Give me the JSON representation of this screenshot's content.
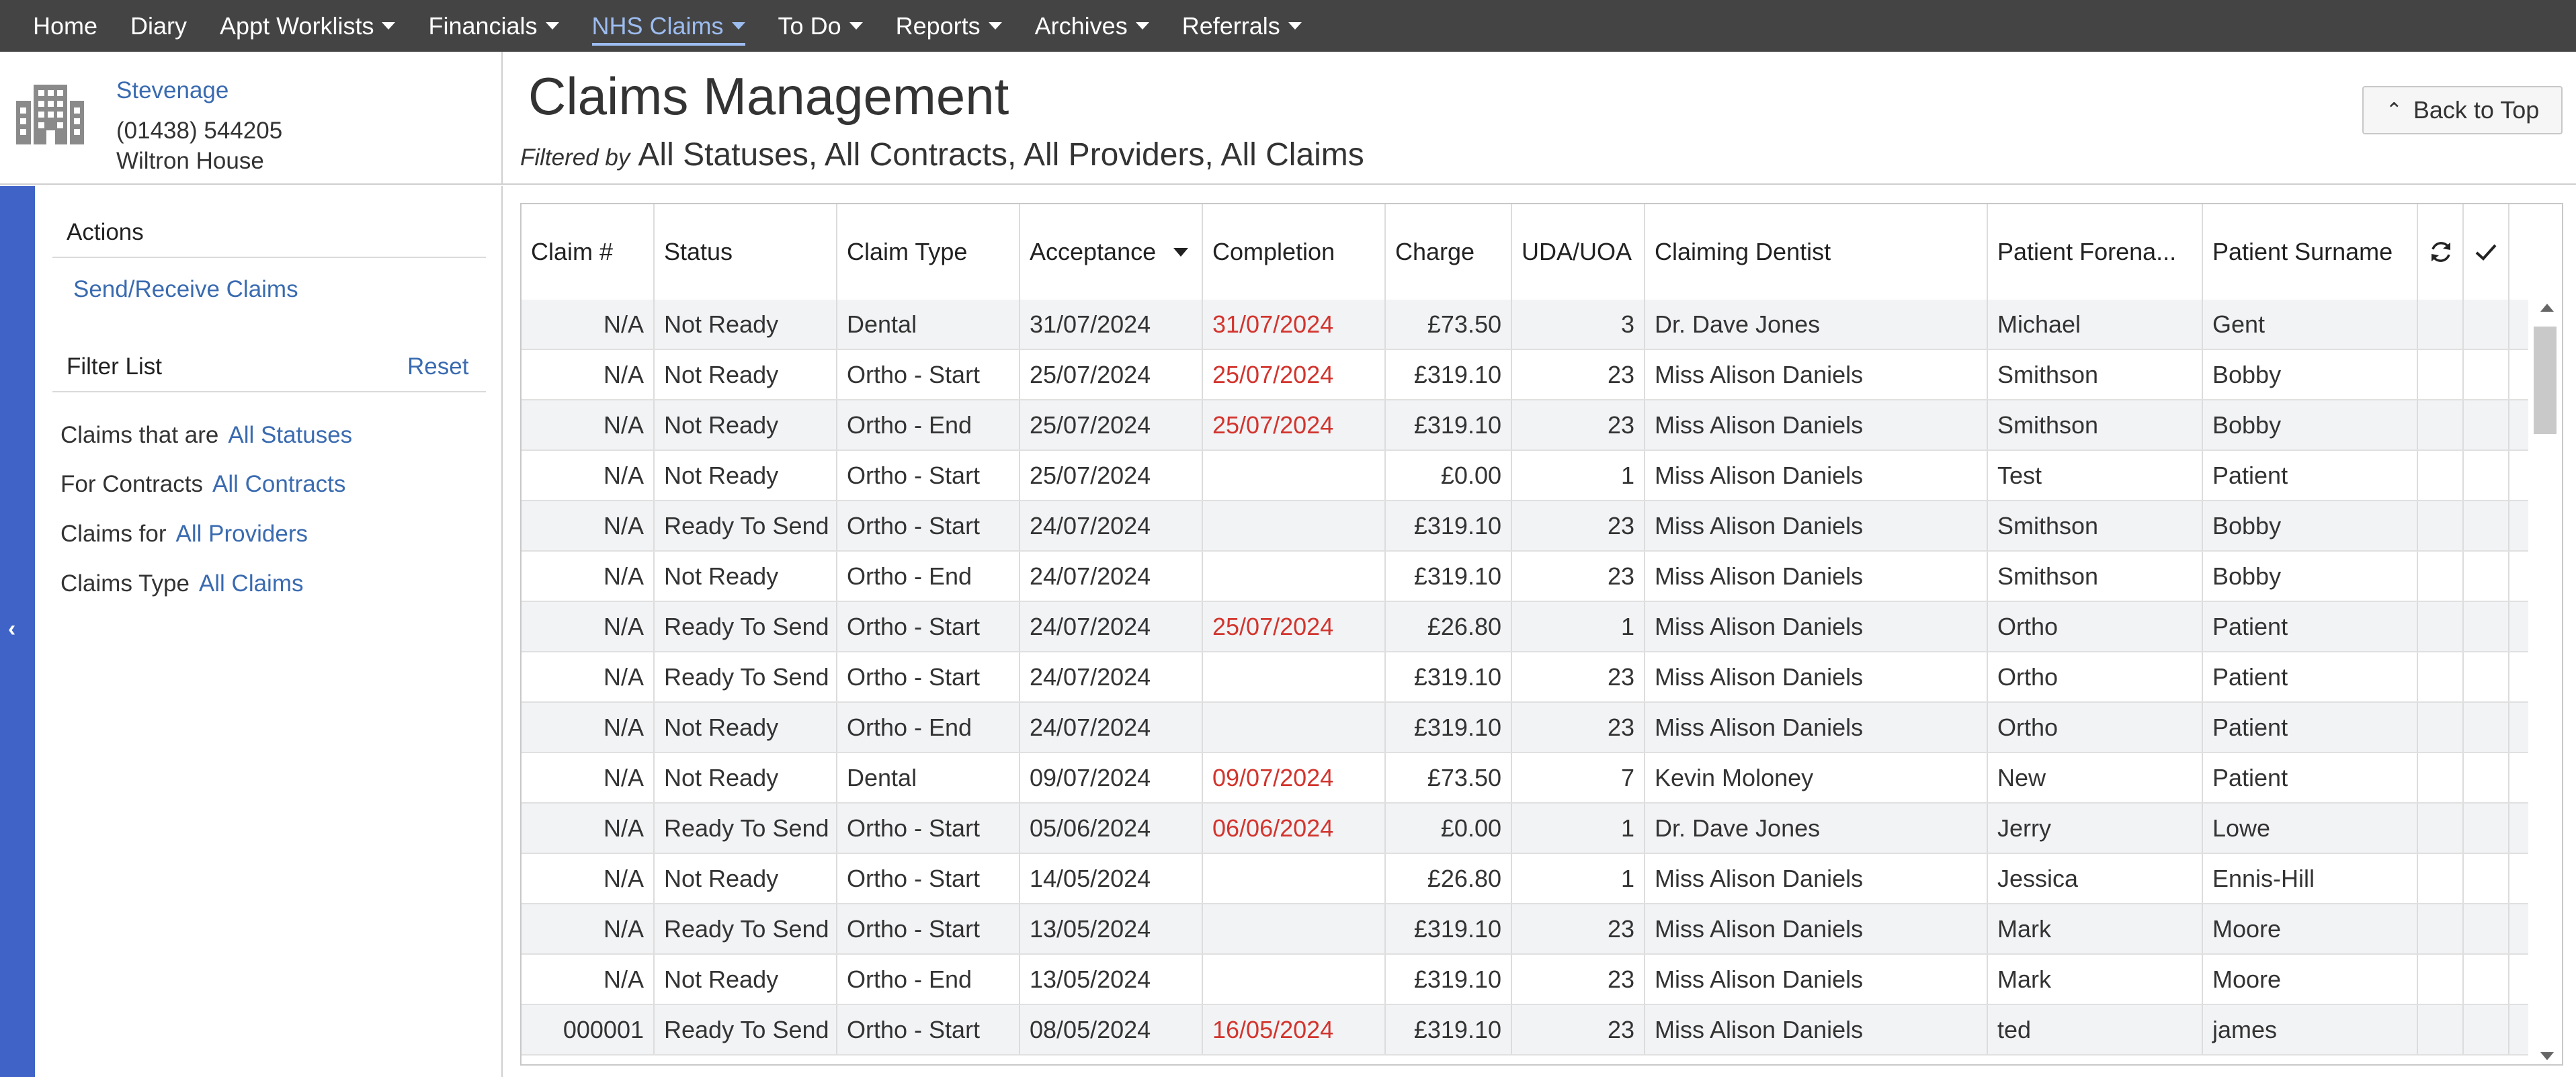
{
  "nav": {
    "items": [
      {
        "label": "Home",
        "dropdown": false,
        "active": false
      },
      {
        "label": "Diary",
        "dropdown": false,
        "active": false
      },
      {
        "label": "Appt Worklists",
        "dropdown": true,
        "active": false
      },
      {
        "label": "Financials",
        "dropdown": true,
        "active": false
      },
      {
        "label": "NHS Claims",
        "dropdown": true,
        "active": true
      },
      {
        "label": "To Do",
        "dropdown": true,
        "active": false
      },
      {
        "label": "Reports",
        "dropdown": true,
        "active": false
      },
      {
        "label": "Archives",
        "dropdown": true,
        "active": false
      },
      {
        "label": "Referrals",
        "dropdown": true,
        "active": false
      }
    ]
  },
  "practice": {
    "name": "Stevenage",
    "phone": "(01438) 544205",
    "address": "Wiltron House",
    "icon": "building-icon"
  },
  "header": {
    "title": "Claims Management",
    "filtered_by_label": "Filtered by",
    "filtered_by_value": "All Statuses, All Contracts, All Providers, All Claims",
    "back_to_top": "Back to Top"
  },
  "sidebar": {
    "actions_heading": "Actions",
    "send_receive": "Send/Receive Claims",
    "filter_heading": "Filter List",
    "reset": "Reset",
    "filters": [
      {
        "label": "Claims that are",
        "value": "All Statuses"
      },
      {
        "label": "For Contracts",
        "value": "All Contracts"
      },
      {
        "label": "Claims for",
        "value": "All Providers"
      },
      {
        "label": "Claims Type",
        "value": "All Claims"
      }
    ]
  },
  "table": {
    "columns": [
      "Claim #",
      "Status",
      "Claim Type",
      "Acceptance",
      "Completion",
      "Charge",
      "UDA/UOA",
      "Claiming Dentist",
      "Patient Forena...",
      "Patient Surname"
    ],
    "rows": [
      {
        "claim": "N/A",
        "status": "Not Ready",
        "type": "Dental",
        "acceptance": "31/07/2024",
        "completion": "31/07/2024",
        "charge": "£73.50",
        "uda": "3",
        "dentist": "Dr. Dave Jones",
        "forename": "Michael",
        "surname": "Gent"
      },
      {
        "claim": "N/A",
        "status": "Not Ready",
        "type": "Ortho - Start",
        "acceptance": "25/07/2024",
        "completion": "25/07/2024",
        "charge": "£319.10",
        "uda": "23",
        "dentist": "Miss Alison Daniels",
        "forename": "Smithson",
        "surname": "Bobby"
      },
      {
        "claim": "N/A",
        "status": "Not Ready",
        "type": "Ortho - End",
        "acceptance": "25/07/2024",
        "completion": "25/07/2024",
        "charge": "£319.10",
        "uda": "23",
        "dentist": "Miss Alison Daniels",
        "forename": "Smithson",
        "surname": "Bobby"
      },
      {
        "claim": "N/A",
        "status": "Not Ready",
        "type": "Ortho - Start",
        "acceptance": "25/07/2024",
        "completion": "",
        "charge": "£0.00",
        "uda": "1",
        "dentist": "Miss Alison Daniels",
        "forename": "Test",
        "surname": "Patient"
      },
      {
        "claim": "N/A",
        "status": "Ready To Send",
        "type": "Ortho - Start",
        "acceptance": "24/07/2024",
        "completion": "",
        "charge": "£319.10",
        "uda": "23",
        "dentist": "Miss Alison Daniels",
        "forename": "Smithson",
        "surname": "Bobby"
      },
      {
        "claim": "N/A",
        "status": "Not Ready",
        "type": "Ortho - End",
        "acceptance": "24/07/2024",
        "completion": "",
        "charge": "£319.10",
        "uda": "23",
        "dentist": "Miss Alison Daniels",
        "forename": "Smithson",
        "surname": "Bobby"
      },
      {
        "claim": "N/A",
        "status": "Ready To Send",
        "type": "Ortho - Start",
        "acceptance": "24/07/2024",
        "completion": "25/07/2024",
        "charge": "£26.80",
        "uda": "1",
        "dentist": "Miss Alison Daniels",
        "forename": "Ortho",
        "surname": "Patient"
      },
      {
        "claim": "N/A",
        "status": "Ready To Send",
        "type": "Ortho - Start",
        "acceptance": "24/07/2024",
        "completion": "",
        "charge": "£319.10",
        "uda": "23",
        "dentist": "Miss Alison Daniels",
        "forename": "Ortho",
        "surname": "Patient"
      },
      {
        "claim": "N/A",
        "status": "Not Ready",
        "type": "Ortho - End",
        "acceptance": "24/07/2024",
        "completion": "",
        "charge": "£319.10",
        "uda": "23",
        "dentist": "Miss Alison Daniels",
        "forename": "Ortho",
        "surname": "Patient"
      },
      {
        "claim": "N/A",
        "status": "Not Ready",
        "type": "Dental",
        "acceptance": "09/07/2024",
        "completion": "09/07/2024",
        "charge": "£73.50",
        "uda": "7",
        "dentist": "Kevin Moloney",
        "forename": "New",
        "surname": "Patient"
      },
      {
        "claim": "N/A",
        "status": "Ready To Send",
        "type": "Ortho - Start",
        "acceptance": "05/06/2024",
        "completion": "06/06/2024",
        "charge": "£0.00",
        "uda": "1",
        "dentist": "Dr. Dave Jones",
        "forename": "Jerry",
        "surname": "Lowe"
      },
      {
        "claim": "N/A",
        "status": "Not Ready",
        "type": "Ortho - Start",
        "acceptance": "14/05/2024",
        "completion": "",
        "charge": "£26.80",
        "uda": "1",
        "dentist": "Miss Alison Daniels",
        "forename": "Jessica",
        "surname": "Ennis-Hill"
      },
      {
        "claim": "N/A",
        "status": "Ready To Send",
        "type": "Ortho - Start",
        "acceptance": "13/05/2024",
        "completion": "",
        "charge": "£319.10",
        "uda": "23",
        "dentist": "Miss Alison Daniels",
        "forename": "Mark",
        "surname": "Moore"
      },
      {
        "claim": "N/A",
        "status": "Not Ready",
        "type": "Ortho - End",
        "acceptance": "13/05/2024",
        "completion": "",
        "charge": "£319.10",
        "uda": "23",
        "dentist": "Miss Alison Daniels",
        "forename": "Mark",
        "surname": "Moore"
      },
      {
        "claim": "000001",
        "status": "Ready To Send",
        "type": "Ortho - Start",
        "acceptance": "08/05/2024",
        "completion": "16/05/2024",
        "charge": "£319.10",
        "uda": "23",
        "dentist": "Miss Alison Daniels",
        "forename": "ted",
        "surname": "james"
      }
    ]
  },
  "colors": {
    "nav_bg": "#444444",
    "nav_active": "#9dbcf0",
    "link": "#3a6bb0",
    "completion_date": "#d2352e",
    "sidebar_strip": "#3f63c7"
  }
}
